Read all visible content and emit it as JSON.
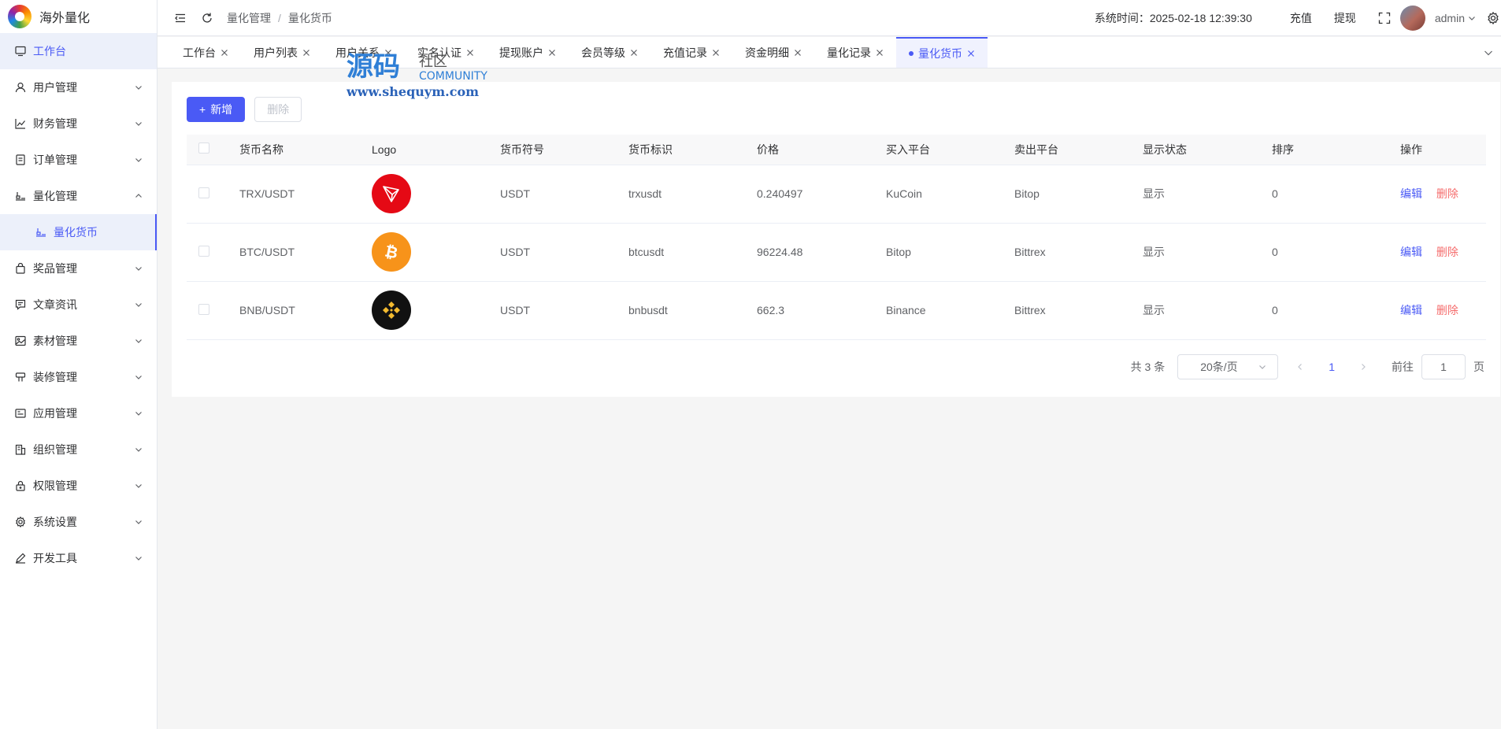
{
  "brand": {
    "name": "海外量化"
  },
  "sidebar": {
    "items": [
      {
        "label": "工作台",
        "icon": "monitor-icon"
      },
      {
        "label": "用户管理",
        "icon": "user-icon"
      },
      {
        "label": "财务管理",
        "icon": "chart-icon"
      },
      {
        "label": "订单管理",
        "icon": "order-icon"
      },
      {
        "label": "量化管理",
        "icon": "quant-icon"
      },
      {
        "label": "量化货币",
        "icon": "coin-icon"
      },
      {
        "label": "奖品管理",
        "icon": "bag-icon"
      },
      {
        "label": "文章资讯",
        "icon": "article-icon"
      },
      {
        "label": "素材管理",
        "icon": "image-icon"
      },
      {
        "label": "装修管理",
        "icon": "decor-icon"
      },
      {
        "label": "应用管理",
        "icon": "app-icon"
      },
      {
        "label": "组织管理",
        "icon": "org-icon"
      },
      {
        "label": "权限管理",
        "icon": "lock-icon"
      },
      {
        "label": "系统设置",
        "icon": "gear-icon"
      },
      {
        "label": "开发工具",
        "icon": "tool-icon"
      }
    ]
  },
  "header": {
    "breadcrumb": [
      "量化管理",
      "量化货币"
    ],
    "system_time": "系统时间：2025-02-18 12:39:30",
    "recharge": "充值",
    "withdraw": "提现",
    "user": "admin"
  },
  "tabs": [
    {
      "label": "工作台"
    },
    {
      "label": "用户列表"
    },
    {
      "label": "用户关系"
    },
    {
      "label": "实名认证"
    },
    {
      "label": "提现账户"
    },
    {
      "label": "会员等级"
    },
    {
      "label": "充值记录"
    },
    {
      "label": "资金明细"
    },
    {
      "label": "量化记录"
    },
    {
      "label": "量化货币"
    }
  ],
  "watermark": {
    "cn": "源码",
    "cn2": "社区",
    "en": "COMMUNITY",
    "url": "www.shequym.com"
  },
  "toolbar": {
    "add": "新增",
    "delete": "删除"
  },
  "table": {
    "headers": [
      "货币名称",
      "Logo",
      "货币符号",
      "货币标识",
      "价格",
      "买入平台",
      "卖出平台",
      "显示状态",
      "排序",
      "操作"
    ],
    "rows": [
      {
        "name": "TRX/USDT",
        "logo": "tron-logo",
        "symbol": "USDT",
        "ident": "trxusdt",
        "price": "0.240497",
        "buy": "KuCoin",
        "sell": "Bitop",
        "status": "显示",
        "sort": "0"
      },
      {
        "name": "BTC/USDT",
        "logo": "bitcoin-logo",
        "symbol": "USDT",
        "ident": "btcusdt",
        "price": "96224.48",
        "buy": "Bitop",
        "sell": "Bittrex",
        "status": "显示",
        "sort": "0"
      },
      {
        "name": "BNB/USDT",
        "logo": "binance-logo",
        "symbol": "USDT",
        "ident": "bnbusdt",
        "price": "662.3",
        "buy": "Binance",
        "sell": "Bittrex",
        "status": "显示",
        "sort": "0"
      }
    ],
    "op_edit": "编辑",
    "op_delete": "删除"
  },
  "pager": {
    "total": "共 3 条",
    "size": "20条/页",
    "current": "1",
    "goto_prefix": "前往",
    "goto_value": "1",
    "goto_suffix": "页"
  },
  "colors": {
    "accent": "#4a5af5",
    "danger": "#f56c6c",
    "tron": "#e50915",
    "bitcoin": "#f7931a",
    "binance": "#f3ba2f"
  }
}
